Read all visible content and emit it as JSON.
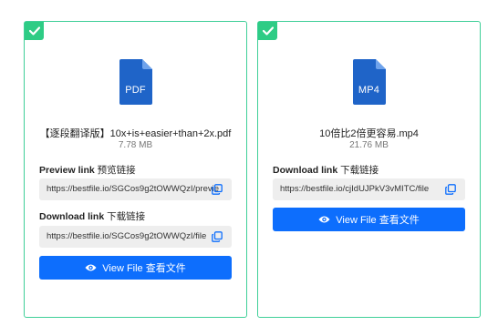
{
  "cards": [
    {
      "file_type": "PDF",
      "file_name": "【逐段翻译版】10x+is+easier+than+2x.pdf",
      "file_size": "7.78 MB",
      "preview_label": "Preview link",
      "preview_label_cn": "预览链接",
      "preview_url": "https://bestfile.io/SGCos9g2tOWWQzI/previe",
      "download_label": "Download link",
      "download_label_cn": "下载链接",
      "download_url": "https://bestfile.io/SGCos9g2tOWWQzI/file",
      "view_button": "View File  查看文件"
    },
    {
      "file_type": "MP4",
      "file_name": "10倍比2倍更容易.mp4",
      "file_size": "21.76 MB",
      "download_label": "Download link",
      "download_label_cn": "下载链接",
      "download_url": "https://bestfile.io/cjIdUJPkV3vMITC/file",
      "view_button": "View File  查看文件"
    }
  ],
  "colors": {
    "card_border": "#3fcf98",
    "check_badge": "#2ecc85",
    "file_icon": "#1f64c8",
    "button": "#0d6efd",
    "link_box": "#eeeeee"
  },
  "icons": [
    "check-icon",
    "file-icon",
    "copy-icon",
    "eye-icon"
  ]
}
